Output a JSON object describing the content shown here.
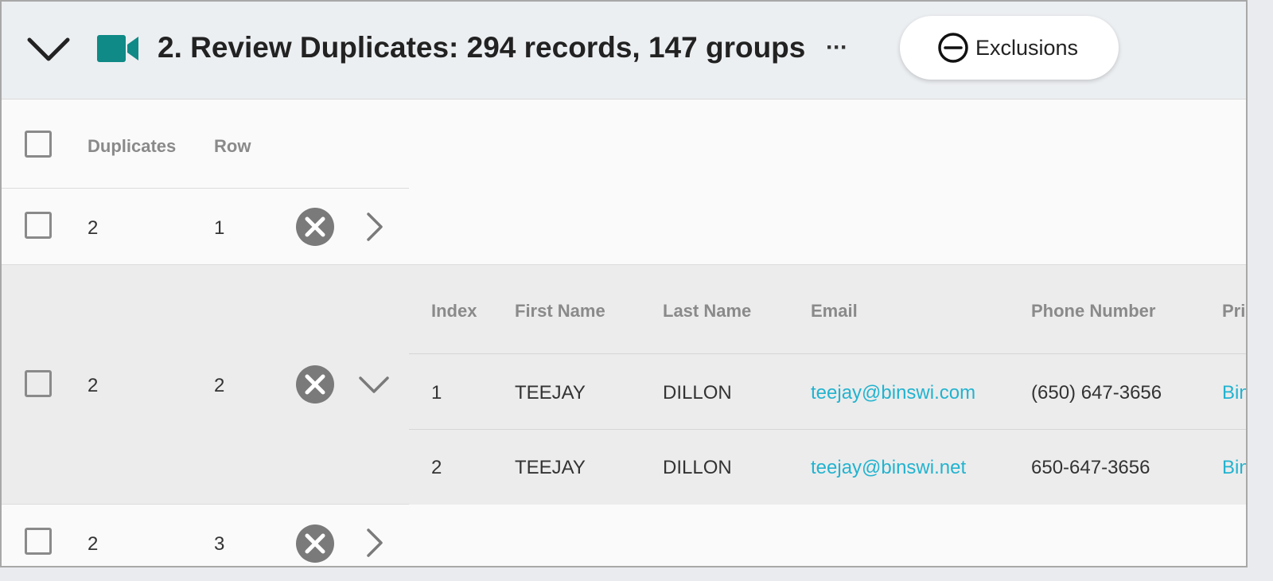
{
  "header": {
    "title": "2. Review Duplicates: 294 records, 147 groups",
    "more_label": "···",
    "exclusions_label": "Exclusions",
    "accent_color": "#0f8a86"
  },
  "table": {
    "columns": {
      "duplicates": "Duplicates",
      "row": "Row"
    },
    "rows": [
      {
        "duplicates": "2",
        "row": "1",
        "expanded": false
      },
      {
        "duplicates": "2",
        "row": "2",
        "expanded": true
      },
      {
        "duplicates": "2",
        "row": "3",
        "expanded": false
      }
    ]
  },
  "detail": {
    "columns": [
      "Index",
      "First Name",
      "Last Name",
      "Email",
      "Phone Number",
      "Pri"
    ],
    "records": [
      {
        "index": "1",
        "first_name": "TEEJAY",
        "last_name": "DILLON",
        "email": "teejay@binswi.com",
        "phone": "(650) 647-3656",
        "pri": "Bin"
      },
      {
        "index": "2",
        "first_name": "TEEJAY",
        "last_name": "DILLON",
        "email": "teejay@binswi.net",
        "phone": "650-647-3656",
        "pri": "Bin"
      }
    ]
  }
}
